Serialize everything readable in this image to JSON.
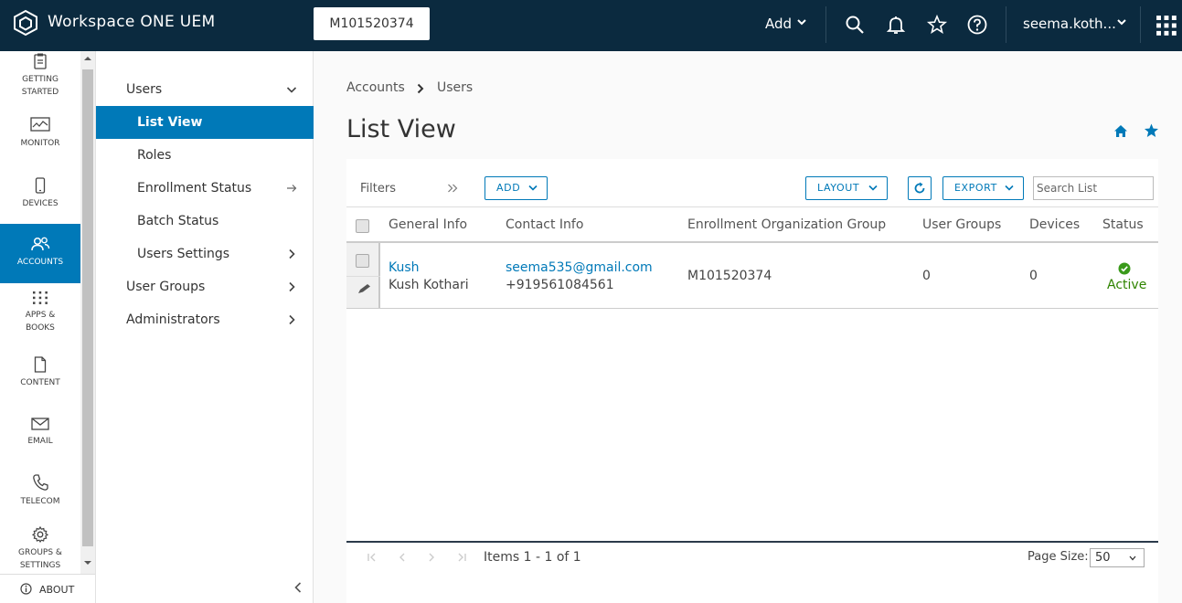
{
  "app": {
    "brand": "Workspace ONE UEM",
    "org_group": "M101520374",
    "add_label": "Add",
    "user": "seema.koth..."
  },
  "rail": {
    "items": [
      {
        "label": "GETTING\nSTARTED",
        "icon": "clipboard-icon"
      },
      {
        "label": "MONITOR",
        "icon": "monitor-icon"
      },
      {
        "label": "DEVICES",
        "icon": "mobile-device-icon"
      },
      {
        "label": "ACCOUNTS",
        "icon": "users-icon",
        "active": true
      },
      {
        "label": "APPS &\nBOOKS",
        "icon": "grid-dots-icon"
      },
      {
        "label": "CONTENT",
        "icon": "document-icon"
      },
      {
        "label": "EMAIL",
        "icon": "envelope-icon"
      },
      {
        "label": "TELECOM",
        "icon": "phone-icon"
      },
      {
        "label": "GROUPS &\nSETTINGS",
        "icon": "gear-icon"
      }
    ],
    "about": "ABOUT"
  },
  "subnav": {
    "users": "Users",
    "list_view": "List View",
    "roles": "Roles",
    "enrollment_status": "Enrollment Status",
    "batch_status": "Batch Status",
    "users_settings": "Users Settings",
    "user_groups": "User Groups",
    "administrators": "Administrators"
  },
  "breadcrumb": [
    "Accounts",
    "Users"
  ],
  "page_title": "List View",
  "toolbar": {
    "filters": "Filters",
    "add": "ADD",
    "layout": "LAYOUT",
    "export": "EXPORT",
    "search_placeholder": "Search List"
  },
  "table": {
    "columns": [
      "General Info",
      "Contact Info",
      "Enrollment Organization Group",
      "User Groups",
      "Devices",
      "Status"
    ],
    "rows": [
      {
        "username": "Kush",
        "full_name": "Kush Kothari",
        "email": "seema535@gmail.com",
        "phone": "+919561084561",
        "org_group": "M101520374",
        "user_groups": "0",
        "devices": "0",
        "status": "Active"
      }
    ]
  },
  "pager": {
    "items": "Items 1 - 1 of 1",
    "page_size_label": "Page Size:",
    "page_size": "50"
  },
  "colors": {
    "topbar": "#0b2a3f",
    "accent": "#0079b8",
    "status_active": "#2f8400"
  }
}
